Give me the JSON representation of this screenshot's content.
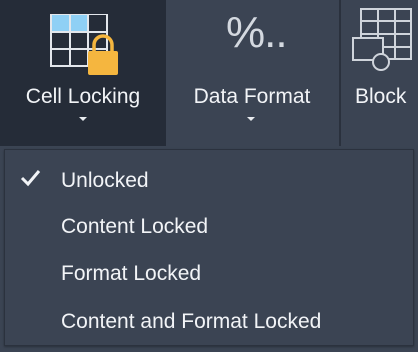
{
  "ribbon": {
    "buttons": [
      {
        "label": "Cell Locking",
        "icon": "cell-lock-icon",
        "state": "active"
      },
      {
        "label": "Data Format",
        "icon": "percent-format-icon",
        "glyph": "%.."
      },
      {
        "label": "Block",
        "icon": "insert-block-icon"
      }
    ]
  },
  "menu": {
    "items": [
      {
        "label": "Unlocked",
        "checked": true
      },
      {
        "label": "Content Locked",
        "checked": false
      },
      {
        "label": "Format Locked",
        "checked": false
      },
      {
        "label": "Content and Format Locked",
        "checked": false
      }
    ]
  },
  "colors": {
    "background": "#3b4453",
    "active_button": "#252c38",
    "text": "#f2f4f7",
    "lock": "#f5b63f",
    "cell_highlight": "#8fd0f5"
  }
}
